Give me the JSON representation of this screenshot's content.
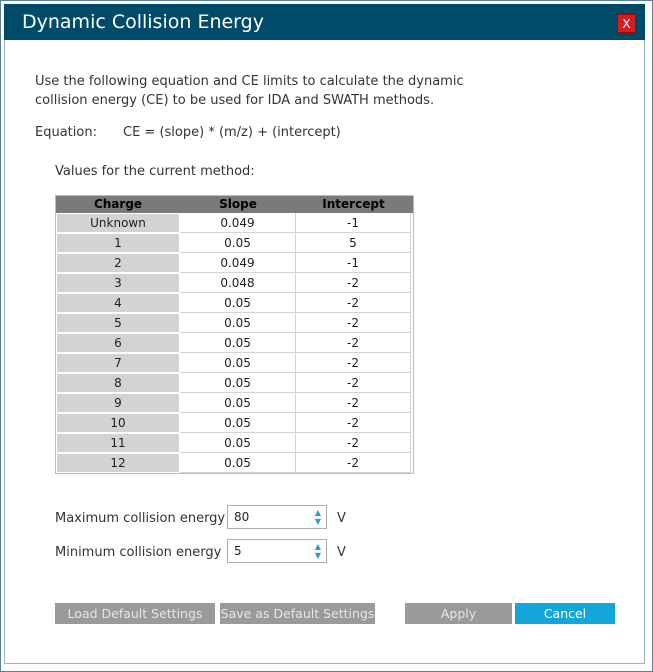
{
  "window": {
    "title": "Dynamic Collision Energy",
    "close_label": "X"
  },
  "description": "Use the following equation and CE limits to calculate the dynamic collision energy (CE) to be used for IDA and SWATH methods.",
  "equation": {
    "label": "Equation:",
    "text": "CE = (slope) * (m/z) + (intercept)"
  },
  "values_label": "Values for the current method:",
  "table": {
    "headers": [
      "Charge",
      "Slope",
      "Intercept"
    ],
    "rows": [
      [
        "Unknown",
        "0.049",
        "-1"
      ],
      [
        "1",
        "0.05",
        "5"
      ],
      [
        "2",
        "0.049",
        "-1"
      ],
      [
        "3",
        "0.048",
        "-2"
      ],
      [
        "4",
        "0.05",
        "-2"
      ],
      [
        "5",
        "0.05",
        "-2"
      ],
      [
        "6",
        "0.05",
        "-2"
      ],
      [
        "7",
        "0.05",
        "-2"
      ],
      [
        "8",
        "0.05",
        "-2"
      ],
      [
        "9",
        "0.05",
        "-2"
      ],
      [
        "10",
        "0.05",
        "-2"
      ],
      [
        "11",
        "0.05",
        "-2"
      ],
      [
        "12",
        "0.05",
        "-2"
      ]
    ]
  },
  "max_ce": {
    "label": "Maximum collision energy",
    "value": "80",
    "unit": "V"
  },
  "min_ce": {
    "label": "Minimum collision energy",
    "value": "5",
    "unit": "V"
  },
  "buttons": {
    "load_default": "Load Default Settings",
    "save_default": "Save as Default Settings",
    "apply": "Apply",
    "cancel": "Cancel"
  },
  "icons": {
    "spin_up": "▲",
    "spin_down": "▼"
  },
  "colors": {
    "titlebar": "#004a6a",
    "close": "#d41e1e",
    "cancel": "#12a6db",
    "disabled_button": "#9a9a9a"
  }
}
